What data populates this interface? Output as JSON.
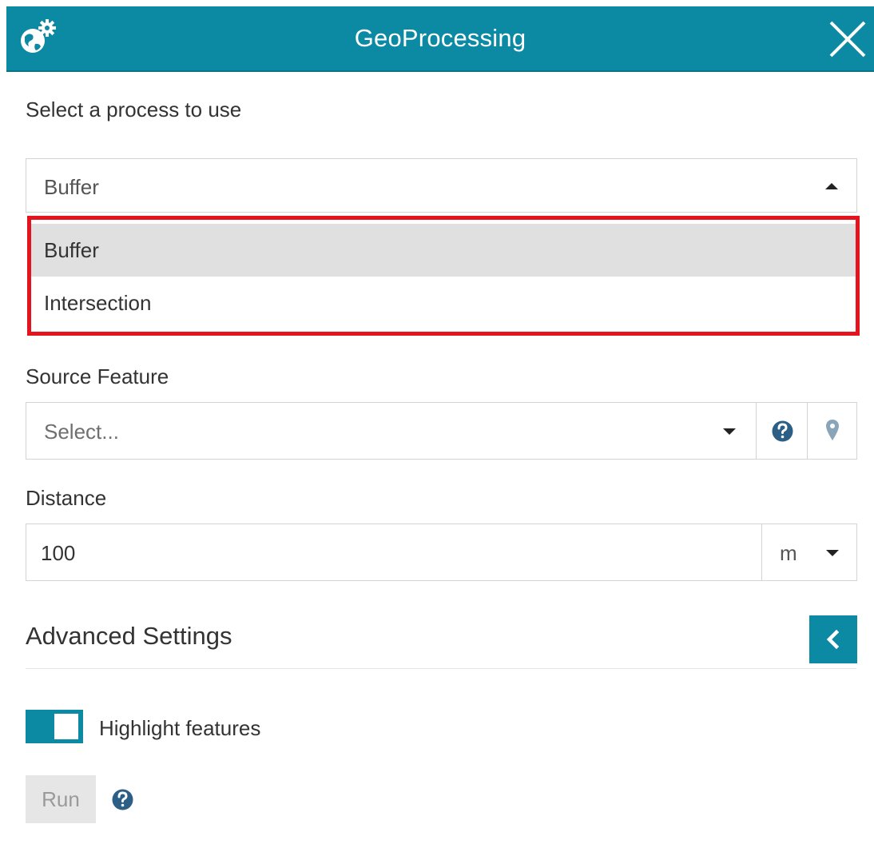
{
  "header": {
    "title": "GeoProcessing",
    "app_icon": "globe-gears-icon",
    "close_icon": "close-icon"
  },
  "process": {
    "label": "Select a process to use",
    "selected_value": "Buffer",
    "dropdown_open": true,
    "options": [
      {
        "label": "Buffer",
        "selected": true
      },
      {
        "label": "Intersection",
        "selected": false
      }
    ]
  },
  "source_feature": {
    "label": "Source Feature",
    "placeholder": "Select...",
    "help_icon": "question-circle-icon",
    "pick_icon": "map-marker-icon"
  },
  "distance": {
    "label": "Distance",
    "value": "100",
    "unit": "m"
  },
  "advanced": {
    "title": "Advanced Settings",
    "collapse_icon": "chevron-left-icon"
  },
  "highlight": {
    "label": "Highlight features",
    "enabled": true
  },
  "run": {
    "label": "Run",
    "help_icon": "question-circle-icon"
  },
  "colors": {
    "accent": "#0c8aa3",
    "highlight_border": "#e3141e",
    "selected_option_bg": "#e0e0e0",
    "help_icon": "#2c5f86",
    "marker_icon": "#8aa4b8"
  }
}
